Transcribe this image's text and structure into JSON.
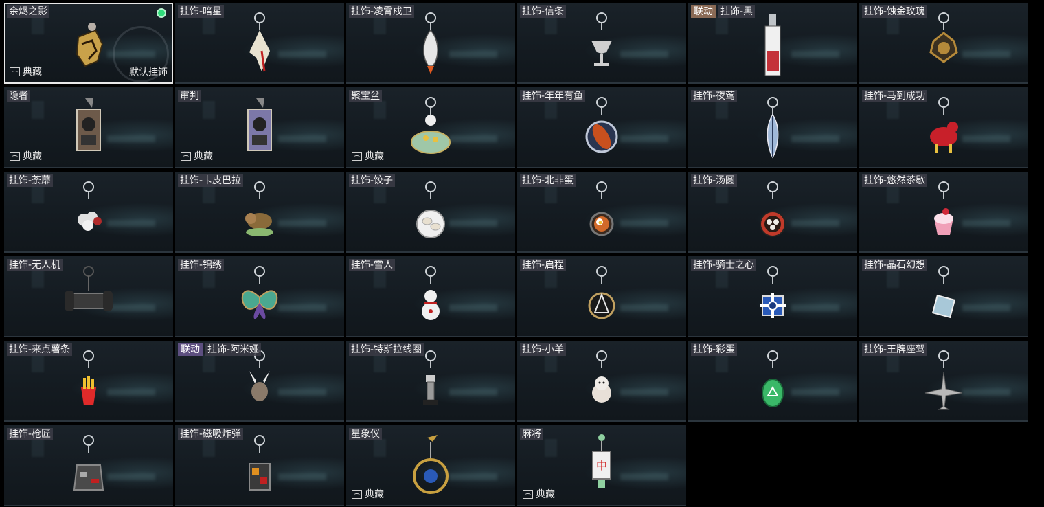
{
  "colors": {
    "selected_outline": "#e8e8e8",
    "equipped_dot": "#2fdc7a",
    "collab_tag": "#8a6a55",
    "collab_tag_alt": "#5d4f80",
    "card_bg": "#161d23"
  },
  "items": [
    {
      "name": "余烬之影",
      "collection": "典藏",
      "default_label": "默认挂饰",
      "selected": true,
      "equipped": true,
      "icon": "dragon-skull-charm",
      "color": "#c9a24a"
    },
    {
      "name": "挂饰-暗星",
      "icon": "blade-charm",
      "color": "#e8e2d0"
    },
    {
      "name": "挂饰-凌霄戍卫",
      "icon": "rocket-charm",
      "color": "#e6e6e6"
    },
    {
      "name": "挂饰-信条",
      "icon": "goblet-charm",
      "color": "#cfcfcf"
    },
    {
      "name": "挂饰-黑",
      "tag": "联动",
      "tag_style": "brown",
      "icon": "tag-plate-charm",
      "color": "#c4323a"
    },
    {
      "name": "挂饰-蚀金玫瑰",
      "icon": "gold-rose-charm",
      "color": "#b58a3a"
    },
    {
      "name": "隐者",
      "collection": "典藏",
      "icon": "tarot-card-charm",
      "color": "#6d5a4a"
    },
    {
      "name": "审判",
      "collection": "典藏",
      "icon": "tarot-card-charm",
      "color": "#7c78a8"
    },
    {
      "name": "聚宝盆",
      "collection": "典藏",
      "icon": "treasure-bowl-charm",
      "color": "#9fc7a8"
    },
    {
      "name": "挂饰-年年有鱼",
      "icon": "fish-charm",
      "color": "#c8501e"
    },
    {
      "name": "挂饰-夜莺",
      "icon": "feather-charm",
      "color": "#9fb8d8"
    },
    {
      "name": "挂饰-马到成功",
      "icon": "horse-charm",
      "color": "#c8202a"
    },
    {
      "name": "挂饰-荼蘼",
      "icon": "flower-charm",
      "color": "#e0e0e0"
    },
    {
      "name": "挂饰-卡皮巴拉",
      "icon": "capybara-charm",
      "color": "#8a6a3a"
    },
    {
      "name": "挂饰-饺子",
      "icon": "dumpling-plate-charm",
      "color": "#e8e0d0"
    },
    {
      "name": "挂饰-北非蛋",
      "icon": "egg-pan-charm",
      "color": "#d26a2a"
    },
    {
      "name": "挂饰-汤圆",
      "icon": "tangyuan-bowl-charm",
      "color": "#c03a2a"
    },
    {
      "name": "挂饰-悠然茶歇",
      "icon": "cupcake-charm",
      "color": "#f0a0b8"
    },
    {
      "name": "挂饰-无人机",
      "icon": "drone-charm",
      "color": "#3a3a3a"
    },
    {
      "name": "挂饰-锦绣",
      "icon": "butterfly-charm",
      "color": "#4aa890"
    },
    {
      "name": "挂饰-雪人",
      "icon": "snowman-charm",
      "color": "#f0f0f0"
    },
    {
      "name": "挂饰-启程",
      "icon": "compass-medal-charm",
      "color": "#c0a060"
    },
    {
      "name": "挂饰-骑士之心",
      "icon": "cross-shield-charm",
      "color": "#2a5ab8"
    },
    {
      "name": "挂饰-晶石幻想",
      "icon": "crystal-cube-charm",
      "color": "#a8c8d8"
    },
    {
      "name": "挂饰-来点薯条",
      "icon": "fries-charm",
      "color": "#e02a2a"
    },
    {
      "name": "挂饰-阿米娅",
      "tag": "联动",
      "tag_style": "purple",
      "icon": "bunny-charm",
      "color": "#8a7a6a"
    },
    {
      "name": "挂饰-特斯拉线圈",
      "icon": "tesla-coil-charm",
      "color": "#9a9a9a"
    },
    {
      "name": "挂饰-小羊",
      "icon": "lamb-charm",
      "color": "#e8e0d8"
    },
    {
      "name": "挂饰-彩蛋",
      "icon": "easter-egg-charm",
      "color": "#3ab868"
    },
    {
      "name": "挂饰-王牌座驾",
      "icon": "jet-charm",
      "color": "#b8b8b8"
    },
    {
      "name": "挂饰-枪匠",
      "icon": "vest-charm",
      "color": "#4a4a4a"
    },
    {
      "name": "挂饰-磁吸炸弹",
      "icon": "bomb-charm",
      "color": "#3a3a3a"
    },
    {
      "name": "星象仪",
      "collection": "典藏",
      "icon": "astrolabe-charm",
      "color": "#c8a040"
    },
    {
      "name": "麻将",
      "collection": "典藏",
      "icon": "mahjong-tile-charm",
      "color": "#f0f0f0"
    }
  ]
}
